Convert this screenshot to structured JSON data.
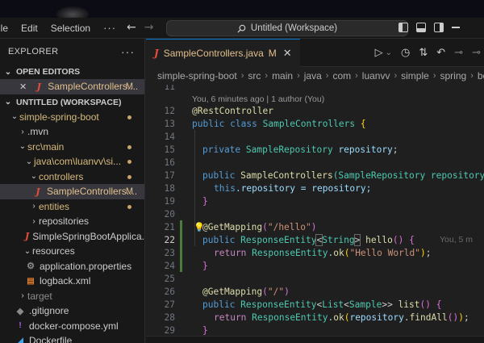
{
  "menu": {
    "file": "ile",
    "edit": "Edit",
    "selection": "Selection",
    "more": "···"
  },
  "command_center": {
    "icon": "search-icon",
    "text": "Untitled (Workspace)"
  },
  "sidebar": {
    "title": "EXPLORER",
    "more": "···",
    "open_editors_label": "OPEN EDITORS",
    "open_editor": {
      "close": "✕",
      "icon": "J",
      "name": "SampleControllers....",
      "badge": "M"
    },
    "workspace_label": "UNTITLED (WORKSPACE)",
    "tree": [
      {
        "label": "simple-spring-boot"
      },
      {
        "label": ".mvn"
      },
      {
        "label": "src\\main"
      },
      {
        "label": "java\\com\\luanvv\\si..."
      },
      {
        "label": "controllers"
      },
      {
        "label": "SampleControllers....",
        "icon": "J",
        "badge": "M"
      },
      {
        "label": "entities"
      },
      {
        "label": "repositories"
      },
      {
        "label": "SimpleSpringBootApplica...",
        "icon": "J"
      },
      {
        "label": "resources"
      },
      {
        "label": "application.properties",
        "icon": "⚙"
      },
      {
        "label": "logback.xml",
        "icon": "▤"
      },
      {
        "label": "target"
      },
      {
        "label": ".gitignore",
        "icon": "◆"
      },
      {
        "label": "docker-compose.yml",
        "icon": "!"
      },
      {
        "label": "Dockerfile",
        "icon": "◢"
      }
    ]
  },
  "tab": {
    "icon": "J",
    "label": "SampleControllers.java",
    "badge": "M",
    "close": "✕"
  },
  "breadcrumbs": [
    "simple-spring-boot",
    "src",
    "main",
    "java",
    "com",
    "luanvv",
    "simple",
    "spring",
    "boot"
  ],
  "code": {
    "lens": "You, 6 minutes ago | 1 author (You)",
    "blame": "You, 5 m",
    "lines": [
      "11",
      "12",
      "13",
      "14",
      "15",
      "16",
      "17",
      "18",
      "19",
      "20",
      "21",
      "22",
      "23",
      "24",
      "25",
      "26",
      "27",
      "28",
      "29"
    ],
    "ann_rest": "@RestController",
    "kw_public": "public",
    "kw_class": "class",
    "cls_name": "SampleControllers",
    "brace_open": "{",
    "kw_private": "private",
    "repo_type": "SampleRepository",
    "repo_var": "repository",
    "semi": ";",
    "ctor_params": "(SampleRepository repository",
    "kw_this": "this",
    "assign": ".repository = repository;",
    "brace_close": "}",
    "ann_get_hello": "@GetMapping",
    "hello_path": "\"/hello\"",
    "resp_entity": "ResponseEntity",
    "type_string": "String",
    "m_hello": "hello",
    "kw_return": "return",
    "m_ok": "ok",
    "str_hello_world": "\"Hello World\"",
    "ann_get_root": "@GetMapping",
    "root_path": "\"/\"",
    "type_list": "List",
    "type_sample": "Sample",
    "m_list": "list",
    "m_findall": "findAll"
  }
}
